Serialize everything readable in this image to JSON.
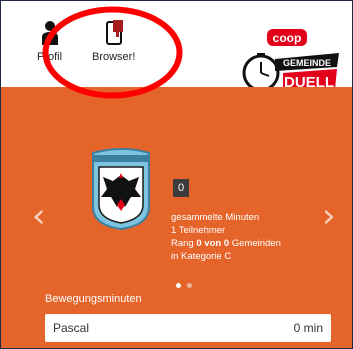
{
  "nav": {
    "profile_label": "Profil",
    "browser_label": "Browser!"
  },
  "logo": {
    "brand": "coop",
    "line1": "GEMEINDE",
    "line2": "DUELL"
  },
  "stats": {
    "score": "0",
    "minutes_label": "gesammelte Minuten",
    "participants": "1 Teilnehmer",
    "rank_prefix": "Rang ",
    "rank_value": "0",
    "rank_mid": " von ",
    "rank_total": "0",
    "rank_suffix": " Gemeinden",
    "category": "in Kategorie C"
  },
  "section": {
    "title": "Bewegungsminuten",
    "rows": [
      {
        "name": "Pascal",
        "value": "0 min"
      }
    ]
  },
  "carousel": {
    "active_index": 0,
    "count": 2
  },
  "colors": {
    "orange": "#e5642a",
    "coop_red": "#e2001a",
    "annotation": "#ff0000"
  }
}
